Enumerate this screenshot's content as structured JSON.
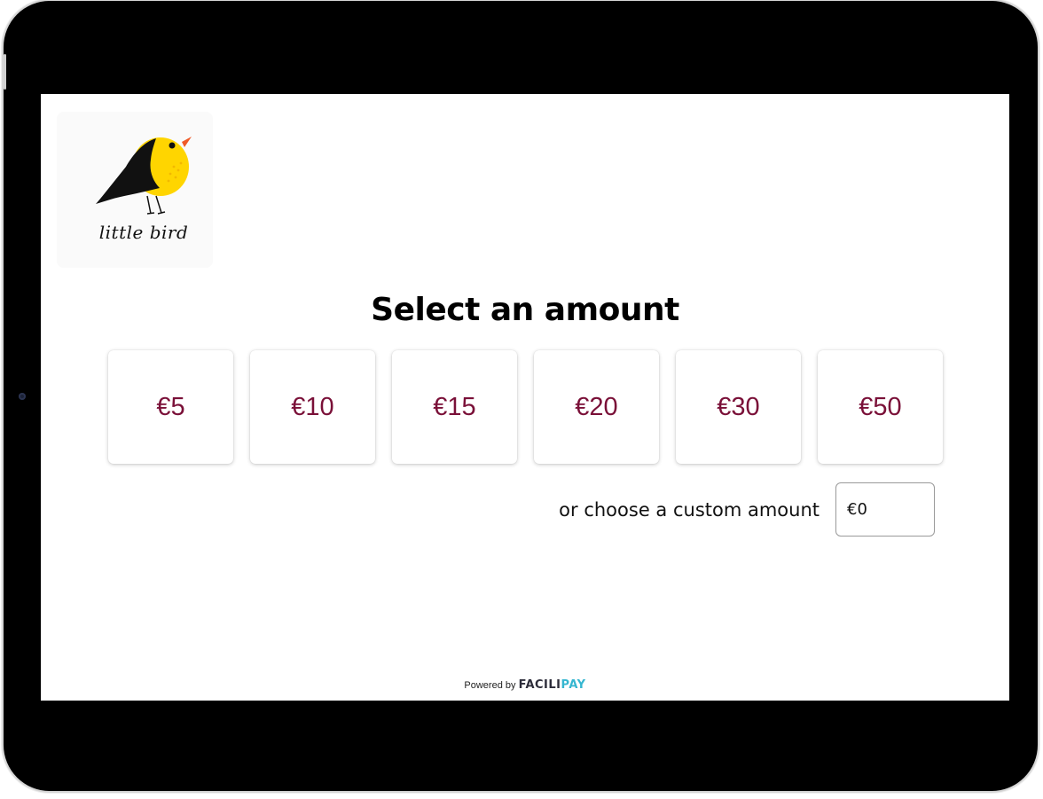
{
  "logo": {
    "text": "little bird"
  },
  "heading": "Select an amount",
  "amounts": [
    "€5",
    "€10",
    "€15",
    "€20",
    "€30",
    "€50"
  ],
  "custom": {
    "label": "or choose a custom amount",
    "value": "€0"
  },
  "footer": {
    "powered_by": "Powered by",
    "brand_part1": "FACILI",
    "brand_part2": "PAY"
  },
  "colors": {
    "amount_text": "#7a1038",
    "brand_accent": "#35b6d0",
    "bird_body": "#ffd500",
    "bird_wing": "#111111",
    "bird_beak": "#f05a28"
  }
}
